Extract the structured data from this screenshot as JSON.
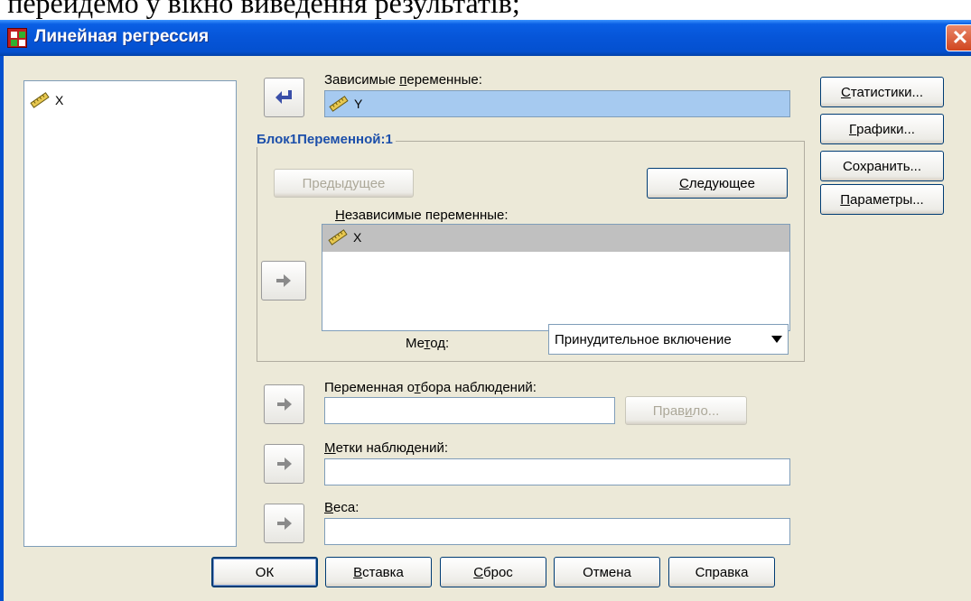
{
  "top_text": "а перейдемо у вікно виведення результатів;",
  "window": {
    "title": "Линейная регрессия",
    "close_glyph": "✕"
  },
  "source_list": {
    "items": [
      {
        "name": "X",
        "icon": "ruler-icon"
      }
    ]
  },
  "dependent": {
    "label_pre": "Зависимые ",
    "label_u": "п",
    "label_post": "еременные:",
    "value": "Y"
  },
  "block": {
    "title": "Блок1Переменной:1",
    "prev_label": "Предыдущее",
    "next_label_u": "С",
    "next_label_post": "ледующее"
  },
  "independent": {
    "label_u": "Н",
    "label_post": "езависимые переменные:",
    "items": [
      {
        "name": "X",
        "icon": "ruler-icon"
      }
    ]
  },
  "method": {
    "label_pre": "Ме",
    "label_u": "т",
    "label_post": "од:",
    "value": "Принудительное включение"
  },
  "selection": {
    "label_pre": "Переменная о",
    "label_u": "т",
    "label_post": "бора наблюдений:",
    "value": "",
    "rule_pre": "Прав",
    "rule_u": "и",
    "rule_post": "ло..."
  },
  "case_labels": {
    "label_u": "М",
    "label_post": "етки наблюдений:",
    "value": ""
  },
  "weights": {
    "label_u": "В",
    "label_post": "еса:",
    "value": ""
  },
  "side_buttons": {
    "statistics_u": "С",
    "statistics_post": "татистики...",
    "plots_u": "Г",
    "plots_post": "рафики...",
    "save": "Сохранить...",
    "options_u": "П",
    "options_post": "араметры..."
  },
  "bottom_buttons": {
    "ok": "ОК",
    "paste_u": "В",
    "paste_post": "ставка",
    "reset_u": "С",
    "reset_post": "брос",
    "cancel": "Отмена",
    "help": "Справка"
  },
  "colors": {
    "titlebar": "#0655d8",
    "dialog_bg": "#ece9d8",
    "selection_highlight": "#a6caf0",
    "group_title": "#1c4faa"
  }
}
